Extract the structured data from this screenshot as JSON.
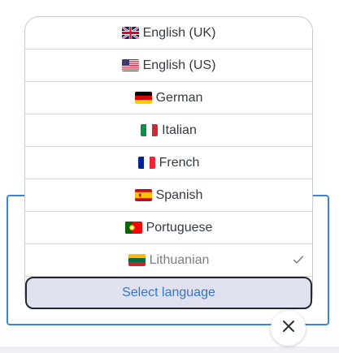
{
  "languages": [
    {
      "label": "English (UK)",
      "flag": "uk-flag-icon"
    },
    {
      "label": "English (US)",
      "flag": "us-flag-icon"
    },
    {
      "label": "German",
      "flag": "germany-flag-icon"
    },
    {
      "label": "Italian",
      "flag": "italy-flag-icon"
    },
    {
      "label": "French",
      "flag": "france-flag-icon"
    },
    {
      "label": "Spanish",
      "flag": "spain-flag-icon"
    },
    {
      "label": "Portuguese",
      "flag": "portugal-flag-icon"
    },
    {
      "label": "Lithuanian",
      "flag": "lithuania-flag-icon",
      "selected": true
    }
  ],
  "select_button": {
    "label": "Select language"
  },
  "close_button": {
    "icon": "close-icon"
  },
  "colors": {
    "accent_blue": "#3a85d6",
    "button_bg": "#dfe2ee",
    "button_text": "#3b73c2",
    "text": "#343a44",
    "muted_text": "#7b8088"
  }
}
